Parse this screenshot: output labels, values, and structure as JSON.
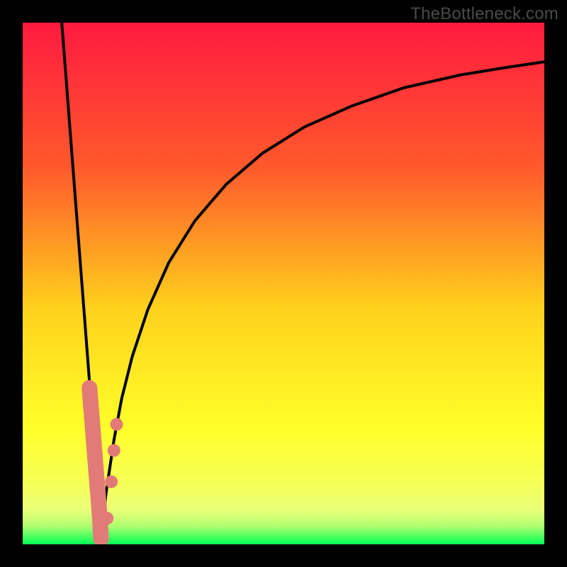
{
  "watermark": "TheBottleneck.com",
  "colors": {
    "bg_black": "#000000",
    "grad_top": "#ff1a3f",
    "grad_mid1": "#ff6a2a",
    "grad_mid2": "#ffd21c",
    "grad_mid3": "#ffff2a",
    "grad_green": "#00ff55",
    "curve": "#000000",
    "marker": "#e27b78"
  },
  "chart_data": {
    "type": "line",
    "title": "",
    "xlabel": "",
    "ylabel": "",
    "xlim": [
      0,
      100
    ],
    "ylim": [
      0,
      100
    ],
    "series": [
      {
        "name": "left-curve",
        "x": [
          7.5,
          8.6,
          9.7,
          10.8,
          11.9,
          13.0,
          14.1,
          14.9
        ],
        "y": [
          100,
          85.7,
          71.4,
          57.1,
          42.9,
          28.6,
          14.3,
          0
        ]
      },
      {
        "name": "right-curve",
        "x": [
          14.9,
          16,
          17.5,
          19,
          21,
          24,
          28,
          33,
          39,
          46,
          54,
          63,
          73,
          84,
          92,
          100
        ],
        "y": [
          0,
          10,
          20,
          28,
          36,
          45,
          54,
          62,
          69,
          75,
          80,
          84,
          87.5,
          90,
          91.3,
          92.5
        ]
      }
    ],
    "markers": {
      "name": "highlighted-points",
      "comment": "pink rounded markers near the valley",
      "points": [
        {
          "x": 12.8,
          "y": 30
        },
        {
          "x": 13.2,
          "y": 25
        },
        {
          "x": 13.6,
          "y": 20
        },
        {
          "x": 14.0,
          "y": 15
        },
        {
          "x": 14.4,
          "y": 10
        },
        {
          "x": 14.8,
          "y": 5
        },
        {
          "x": 15.0,
          "y": 1
        },
        {
          "x": 16.2,
          "y": 5
        },
        {
          "x": 17.0,
          "y": 12
        },
        {
          "x": 17.5,
          "y": 18
        },
        {
          "x": 18.0,
          "y": 23
        }
      ]
    }
  }
}
